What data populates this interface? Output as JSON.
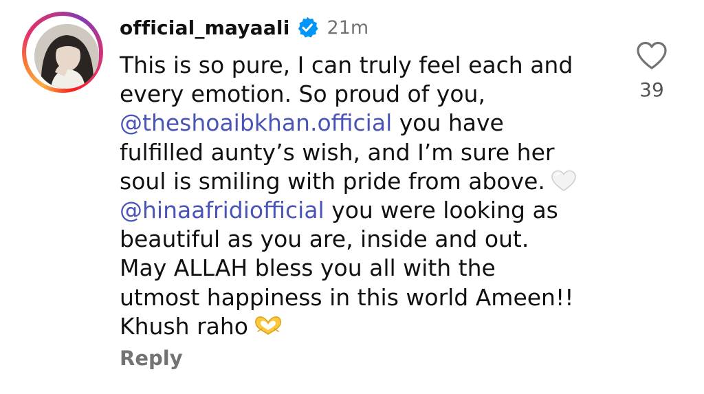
{
  "comment": {
    "author": {
      "username": "official_mayaali",
      "verified": true,
      "avatar": "profile-photo"
    },
    "timestamp": "21m",
    "lines": [
      [
        {
          "t": "This is so pure, I can truly feel each and"
        }
      ],
      [
        {
          "t": "every emotion. So proud of you,"
        }
      ],
      [
        {
          "t": "@theshoaibkhan.official",
          "mention": true
        },
        {
          "t": " you have"
        }
      ],
      [
        {
          "t": "fulfilled aunty’s wish, and I’m sure her"
        }
      ],
      [
        {
          "t": "soul is smiling with pride from above."
        },
        {
          "emoji": "white-heart-emoji"
        }
      ],
      [
        {
          "t": "@hinaafridiofficial",
          "mention": true
        },
        {
          "t": " you were looking as"
        }
      ],
      [
        {
          "t": "beautiful as you are, inside and out."
        }
      ],
      [
        {
          "t": "May ALLAH bless you all with the"
        }
      ],
      [
        {
          "t": "utmost happiness in this world Ameen!!"
        }
      ],
      [
        {
          "t": "Khush raho"
        },
        {
          "emoji": "heart-hands-emoji"
        }
      ]
    ],
    "reply_label": "Reply",
    "like": {
      "icon": "heart-outline-icon",
      "count": "39"
    }
  },
  "colors": {
    "mention": "#4a54b8",
    "muted": "#737373",
    "verified_badge": "#0095f6",
    "text": "#111111"
  }
}
